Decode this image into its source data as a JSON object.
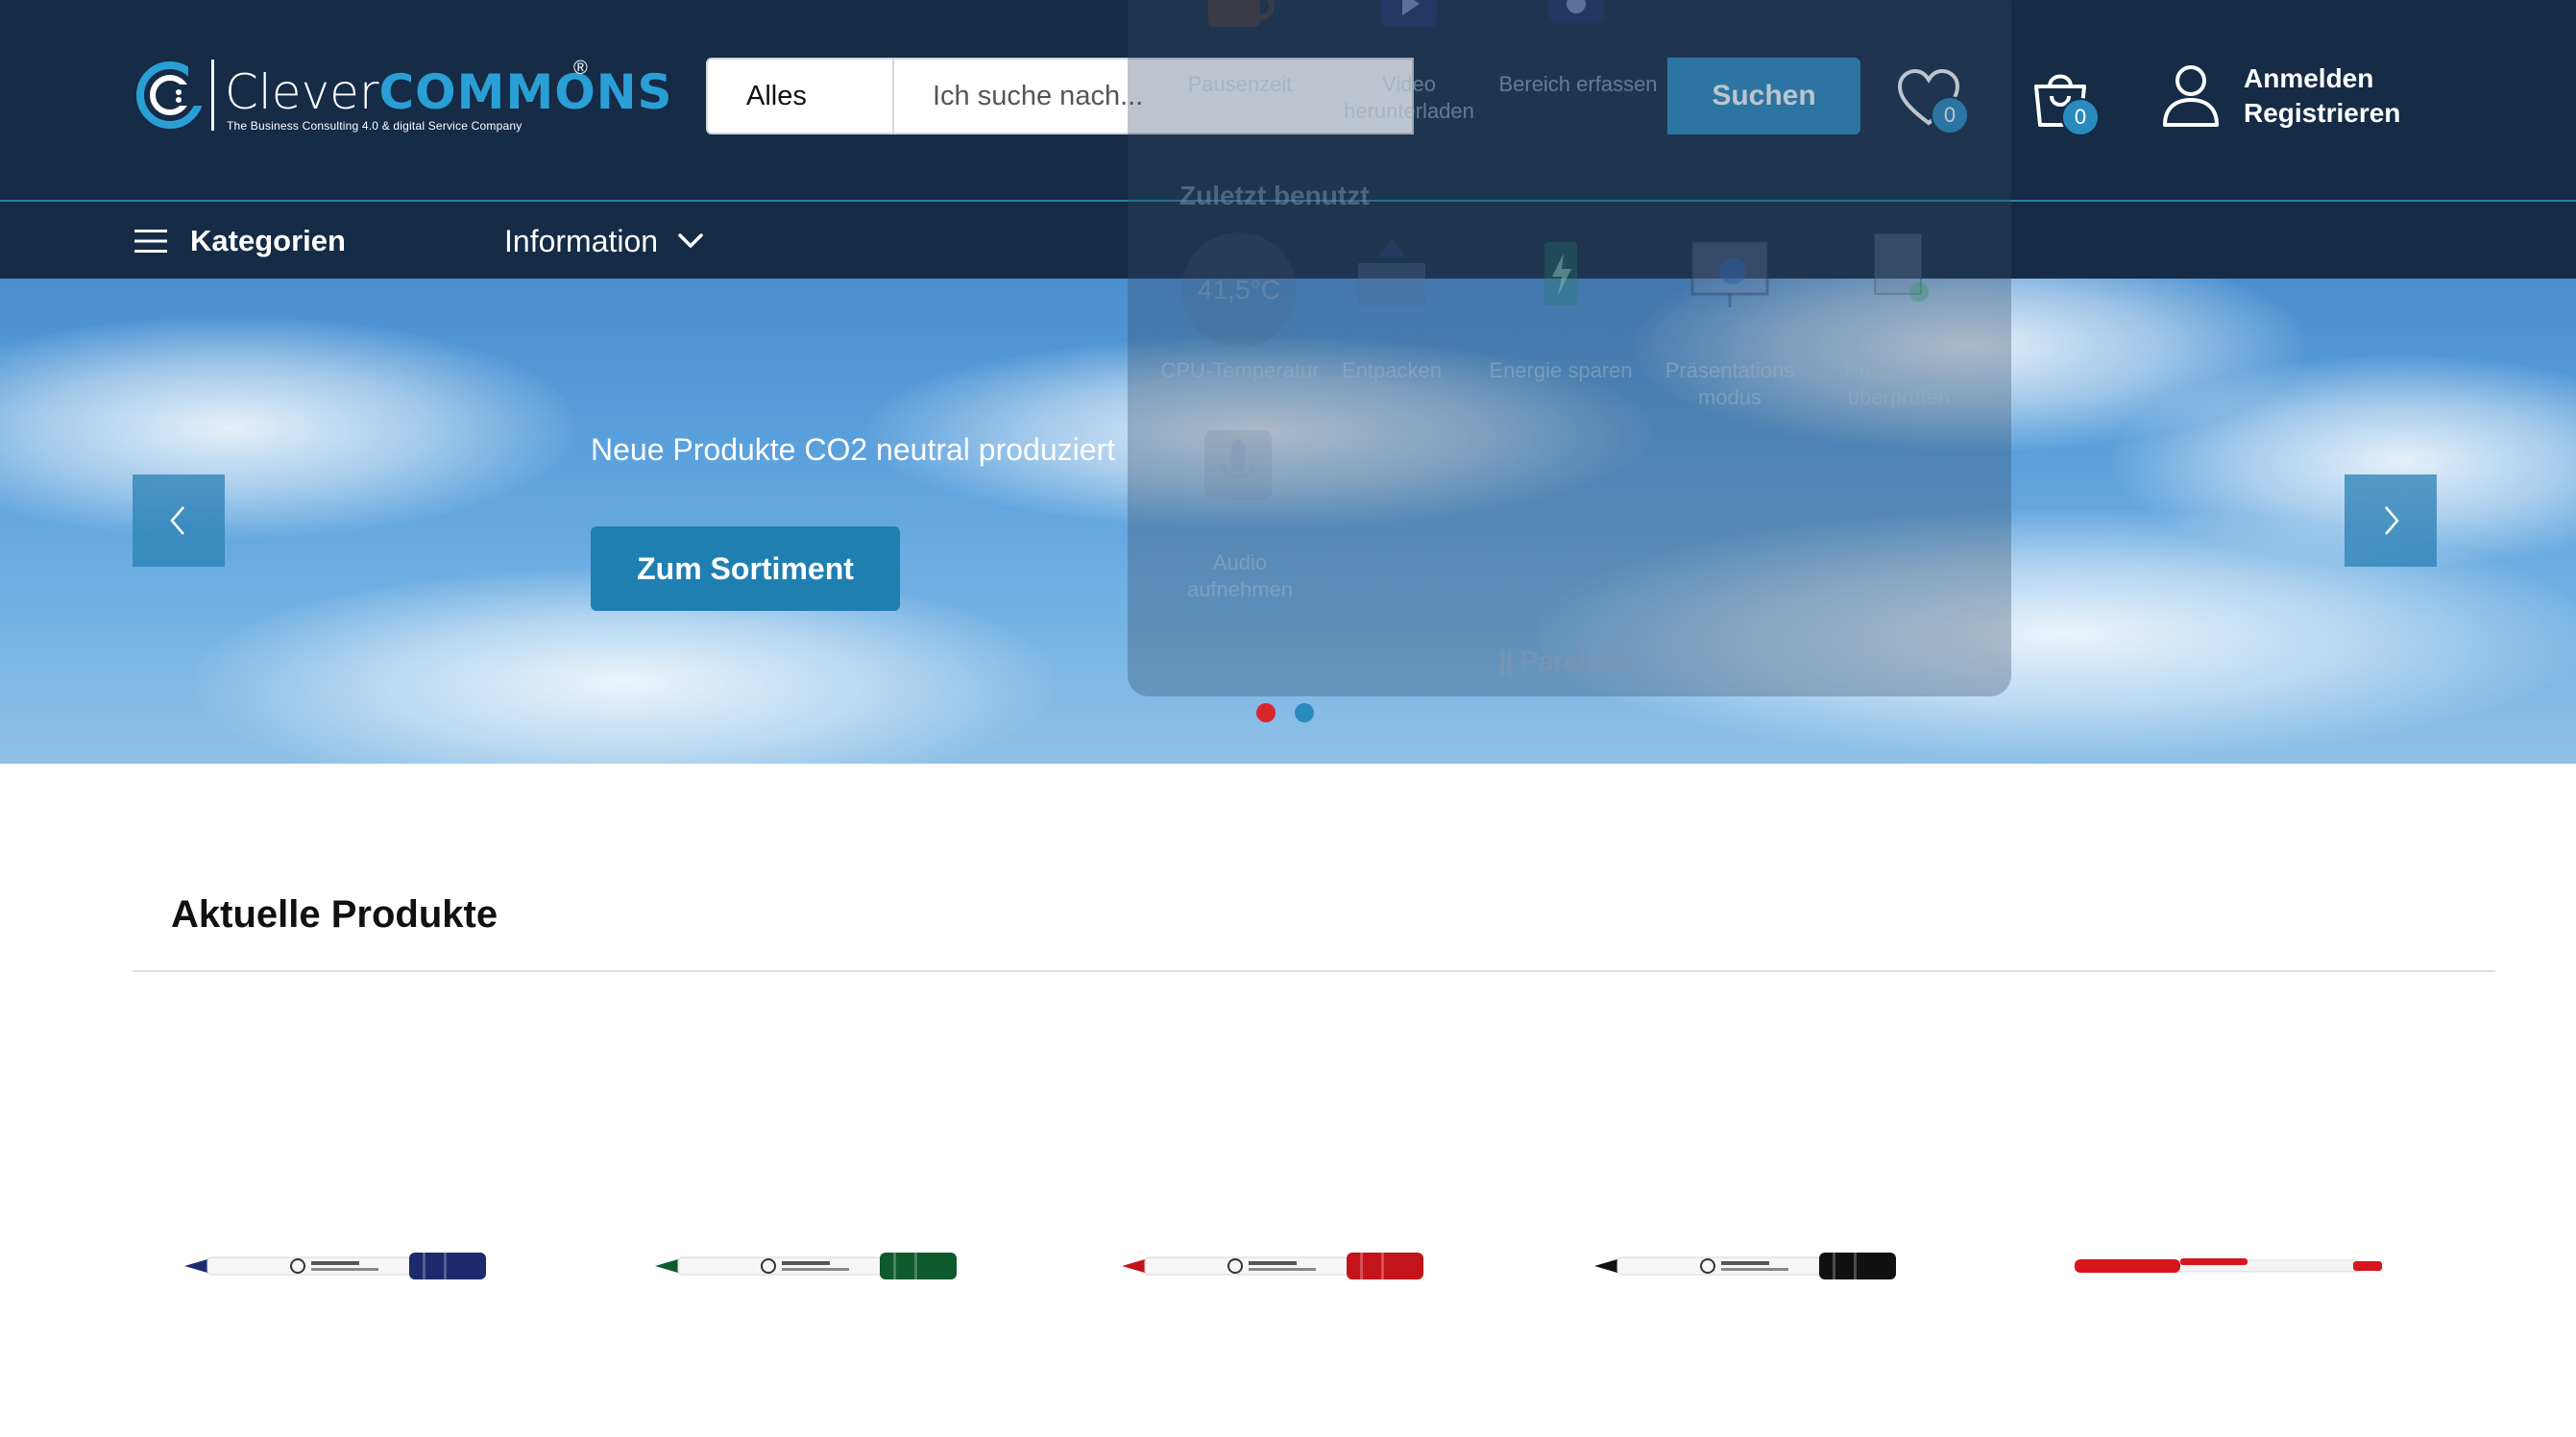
{
  "brand": {
    "name_part1": "Clever",
    "name_part2": "COMMONS",
    "registered": "®",
    "tagline": "The Business Consulting 4.0 & digital Service Company"
  },
  "search": {
    "category": "Alles",
    "placeholder": "Ich suche nach...",
    "button": "Suchen"
  },
  "header": {
    "wishlist_count": "0",
    "cart_count": "0",
    "login": "Anmelden",
    "register": "Registrieren"
  },
  "nav": {
    "categories": "Kategorien",
    "information": "Information"
  },
  "hero": {
    "title": "Neue Produkte CO2 neutral produziert",
    "button": "Zum Sortiment",
    "dots": [
      "#d9262c",
      "#2a8abe"
    ]
  },
  "overlay": {
    "row1": [
      "Pausenzeit",
      "Video herunterladen",
      "Bereich erfassen"
    ],
    "recent_heading": "Zuletzt benutzt",
    "cpu_temp": "41,5°C",
    "row2": [
      "CPU-Temperatur",
      "Entpacken",
      "Energie sparen",
      "Präsentations modus",
      "Prüfsumme überprüfen"
    ],
    "row3": [
      "Audio aufnehmen"
    ],
    "brand": "|| Parallels"
  },
  "products": {
    "title": "Aktuelle Produkte",
    "items": [
      {
        "color": "#1d2a6b",
        "type": "marker"
      },
      {
        "color": "#0e5a2c",
        "type": "marker"
      },
      {
        "color": "#c4141b",
        "type": "marker"
      },
      {
        "color": "#111111",
        "type": "marker"
      },
      {
        "color": "#d8151c",
        "type": "pen"
      }
    ]
  },
  "colors": {
    "header_bg": "#152b46",
    "accent": "#2a8abe"
  }
}
